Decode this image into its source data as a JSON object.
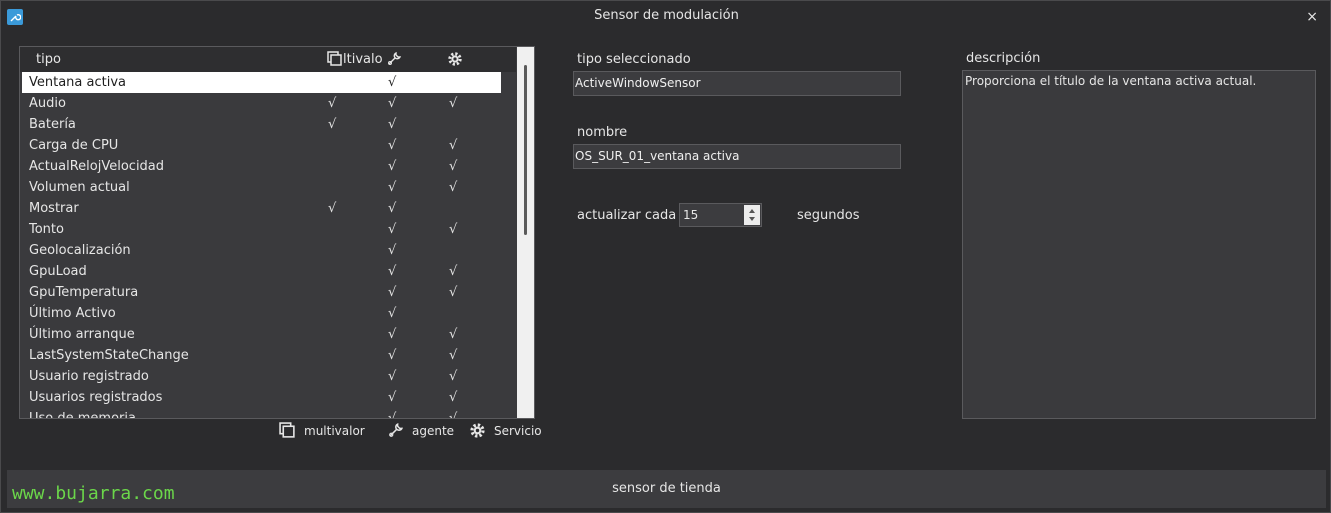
{
  "window": {
    "title": "Sensor de modulación",
    "close_glyph": "×",
    "app_icon": "wrench-icon"
  },
  "list": {
    "headers": {
      "tipo": "tipo",
      "multivalor": "ltivalo"
    },
    "rows": [
      {
        "name": "Ventana activa",
        "c1": "",
        "c2": "√",
        "c3": "",
        "selected": true
      },
      {
        "name": "Audio",
        "c1": "√",
        "c2": "√",
        "c3": "√"
      },
      {
        "name": "Batería",
        "c1": "√",
        "c2": "√",
        "c3": ""
      },
      {
        "name": "Carga de CPU",
        "c1": "",
        "c2": "√",
        "c3": "√"
      },
      {
        "name": "ActualRelojVelocidad",
        "c1": "",
        "c2": "√",
        "c3": "√"
      },
      {
        "name": "Volumen actual",
        "c1": "",
        "c2": "√",
        "c3": "√"
      },
      {
        "name": "Mostrar",
        "c1": "√",
        "c2": "√",
        "c3": ""
      },
      {
        "name": "Tonto",
        "c1": "",
        "c2": "√",
        "c3": "√"
      },
      {
        "name": "Geolocalización",
        "c1": "",
        "c2": "√",
        "c3": ""
      },
      {
        "name": "GpuLoad",
        "c1": "",
        "c2": "√",
        "c3": "√"
      },
      {
        "name": "GpuTemperatura",
        "c1": "",
        "c2": "√",
        "c3": "√"
      },
      {
        "name": "Último Activo",
        "c1": "",
        "c2": "√",
        "c3": ""
      },
      {
        "name": "Último arranque",
        "c1": "",
        "c2": "√",
        "c3": "√"
      },
      {
        "name": "LastSystemStateChange",
        "c1": "",
        "c2": "√",
        "c3": "√"
      },
      {
        "name": "Usuario registrado",
        "c1": "",
        "c2": "√",
        "c3": "√"
      },
      {
        "name": "Usuarios registrados",
        "c1": "",
        "c2": "√",
        "c3": "√"
      },
      {
        "name": "Uso de memoria",
        "c1": "",
        "c2": "√",
        "c3": "√"
      }
    ]
  },
  "legend": {
    "multivalor": "multivalor",
    "agente": "agente",
    "servicio": "Servicio"
  },
  "form": {
    "tipo_label": "tipo seleccionado",
    "tipo_value": "ActiveWindowSensor",
    "nombre_label": "nombre",
    "nombre_value": "OS_SUR_01_ventana activa",
    "actualizar_label": "actualizar cada",
    "actualizar_value": "15",
    "segundos_label": "segundos"
  },
  "description": {
    "label": "descripción",
    "text": "Proporciona el título de la ventana activa actual."
  },
  "footer": {
    "store_button": "sensor de tienda",
    "watermark": "www.bujarra.com"
  },
  "colors": {
    "background": "#2b2b2d",
    "panel": "#3a3a3d",
    "watermark": "#6bd64a",
    "selection": "#ffffff"
  }
}
